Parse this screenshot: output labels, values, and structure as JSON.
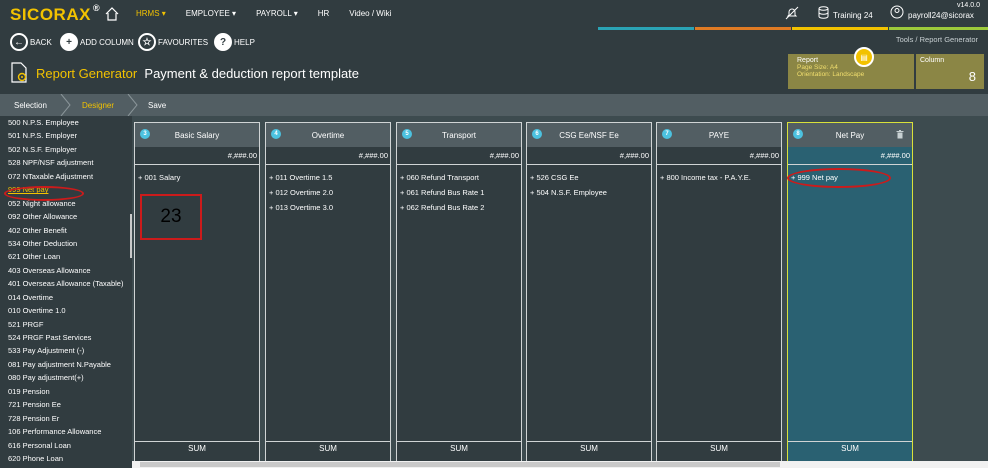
{
  "app": {
    "logo": "SICORAX",
    "logo_mark": "®",
    "version": "v14.0.0"
  },
  "nav": {
    "items": [
      {
        "label": "HRMS ▾",
        "active": true
      },
      {
        "label": "EMPLOYEE ▾",
        "active": false
      },
      {
        "label": "PAYROLL ▾",
        "active": false
      },
      {
        "label": "HR",
        "active": false
      },
      {
        "label": "Video / Wiki",
        "active": false
      }
    ],
    "training": "Training 24",
    "user": "payroll24@sicorax"
  },
  "toolbar": {
    "back": "BACK",
    "add_column": "ADD COLUMN",
    "favourites": "FAVOURITES",
    "help": "HELP"
  },
  "breadcrumb": {
    "parent": "Tools /",
    "current": "Report Generator"
  },
  "page": {
    "app_name": "Report Generator",
    "title": "Payment & deduction report template"
  },
  "report_card": {
    "label": "Report",
    "page_size": "Page Size: A4",
    "orientation": "Orientation: Landscape"
  },
  "column_card": {
    "label": "Column",
    "count": "8"
  },
  "steps": [
    {
      "label": "Selection",
      "active": false
    },
    {
      "label": "Designer",
      "active": true
    },
    {
      "label": "Save",
      "active": false
    }
  ],
  "sidebar": {
    "items": [
      "500 N.P.S. Employee",
      "501 N.P.S. Employer",
      "502 N.S.F. Employer",
      "528 NPF/NSF adjustment",
      "072 NTaxable Adjustment",
      "999 Net pay",
      "052 Night allowance",
      "092 Other Allowance",
      "402 Other Benefit",
      "534 Other Deduction",
      "621 Other Loan",
      "403 Overseas Allowance",
      "401 Overseas Allowance (Taxable)",
      "014 Overtime",
      "010 Overtime 1.0",
      "521 PRGF",
      "524 PRGF Past Services",
      "533 Pay Adjustment (-)",
      "081 Pay adjustment N.Payable",
      "080 Pay adjustment(+)",
      "019 Pension",
      "721 Pension Ee",
      "728 Pension Er",
      "106 Performance Allowance",
      "616 Personal Loan",
      "620 Phone Loan"
    ],
    "highlighted_index": 5
  },
  "columns": [
    {
      "num": "3",
      "title": "Basic Salary",
      "format": "#,###.00",
      "items": [
        "+ 001 Salary"
      ],
      "footer": "SUM",
      "selected": false
    },
    {
      "num": "4",
      "title": "Overtime",
      "format": "#,###.00",
      "items": [
        "+ 011 Overtime 1.5",
        "+ 012 Overtime 2.0",
        "+ 013 Overtime 3.0"
      ],
      "footer": "SUM",
      "selected": false
    },
    {
      "num": "5",
      "title": "Transport",
      "format": "#,###.00",
      "items": [
        "+ 060 Refund Transport",
        "+ 061 Refund Bus Rate 1",
        "+ 062 Refund Bus Rate 2"
      ],
      "footer": "SUM",
      "selected": false
    },
    {
      "num": "6",
      "title": "CSG Ee/NSF Ee",
      "format": "#,###.00",
      "items": [
        "+ 526 CSG Ee",
        "+ 504 N.S.F. Employee"
      ],
      "footer": "SUM",
      "selected": false
    },
    {
      "num": "7",
      "title": "PAYE",
      "format": "#,###.00",
      "items": [
        "+ 800 Income tax - P.A.Y.E."
      ],
      "footer": "SUM",
      "selected": false
    },
    {
      "num": "8",
      "title": "Net Pay",
      "format": "#,###.00",
      "items": [
        "+ 999 Net pay"
      ],
      "footer": "SUM",
      "selected": true
    }
  ],
  "annotation": {
    "label": "23"
  },
  "colors": {
    "accent": "#f2c200",
    "bar_dark": "#313c40",
    "steps_bar": "#525e63",
    "selected_column": "#2a6172",
    "stripe_teal": "#2aa3b5",
    "stripe_orange": "#e07b24",
    "stripe_yellow": "#f2c200",
    "stripe_green": "#9cc93b",
    "annotation_red": "#cc1b1b"
  }
}
